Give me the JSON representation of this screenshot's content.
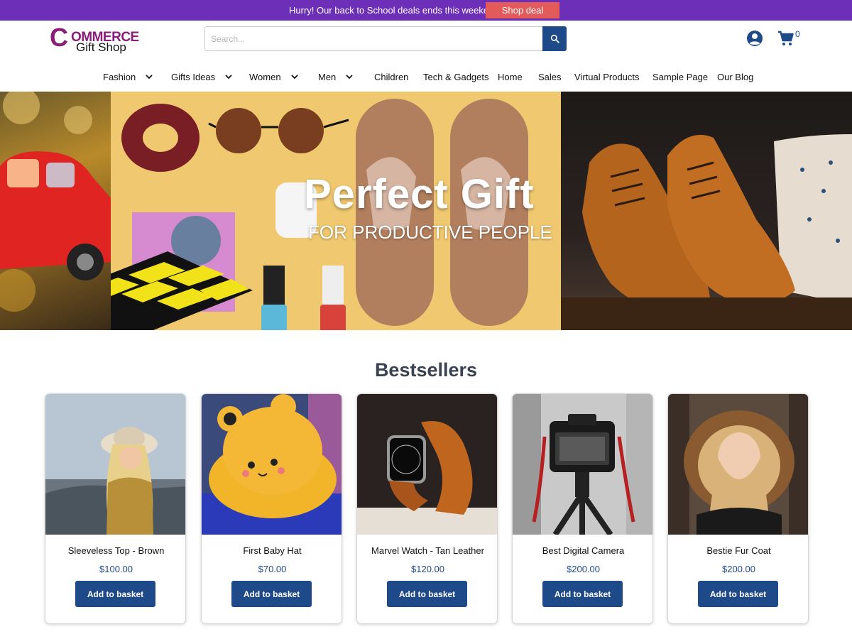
{
  "promo": {
    "text": "Hurry! Our back to School deals ends this weekend",
    "button": "Shop deal",
    "bar_color": "#6d2fb8",
    "button_color": "#e25a5a"
  },
  "header": {
    "logo_line1_first": "C",
    "logo_line1_rest": "OMMERCE",
    "logo_line2": "Gift Shop",
    "search_placeholder": "Search...",
    "cart_count": "0",
    "icons": {
      "search": "search-icon",
      "account": "user-circle-icon",
      "cart": "shopping-cart-icon"
    }
  },
  "nav": {
    "items": [
      {
        "label": "Fashion",
        "has_dropdown": true
      },
      {
        "label": "Gifts Ideas",
        "has_dropdown": true
      },
      {
        "label": "Women",
        "has_dropdown": true
      },
      {
        "label": "Men",
        "has_dropdown": true
      },
      {
        "label": "Children",
        "has_dropdown": false
      },
      {
        "label": "Tech & Gadgets",
        "has_dropdown": false
      },
      {
        "label": "Home",
        "has_dropdown": false
      },
      {
        "label": "Sales",
        "has_dropdown": false
      },
      {
        "label": "Virtual Products",
        "has_dropdown": false
      },
      {
        "label": "Sample Page",
        "has_dropdown": false
      },
      {
        "label": "Our Blog",
        "has_dropdown": false
      }
    ]
  },
  "hero": {
    "title": "Perfect Gift",
    "subtitle": "FOR PRODUCTIVE PEOPLE"
  },
  "bestsellers": {
    "title": "Bestsellers",
    "button_label": "Add to basket",
    "products": [
      {
        "name": "Sleeveless Top - Brown",
        "price": "$100.00",
        "image": "woman-in-hat-photo"
      },
      {
        "name": "First Baby Hat",
        "price": "$70.00",
        "image": "yellow-bear-hat-photo"
      },
      {
        "name": "Marvel Watch - Tan Leather",
        "price": "$120.00",
        "image": "smartwatch-photo"
      },
      {
        "name": "Best Digital Camera",
        "price": "$200.00",
        "image": "camera-on-tripod-photo"
      },
      {
        "name": "Bestie Fur Coat",
        "price": "$200.00",
        "image": "woman-fur-hood-photo"
      }
    ]
  },
  "colors": {
    "primary": "#1e4a8a",
    "brand": "#8a1c7a"
  }
}
